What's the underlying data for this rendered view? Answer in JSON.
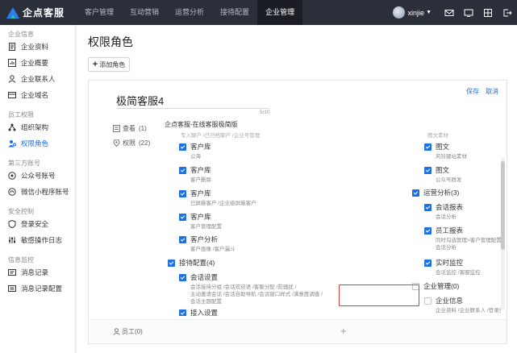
{
  "app": {
    "logo_text": "企点客服"
  },
  "nav": [
    {
      "label": "客户管理"
    },
    {
      "label": "互动营销"
    },
    {
      "label": "运营分析"
    },
    {
      "label": "接待配置"
    },
    {
      "label": "企业管理",
      "active": true
    }
  ],
  "user": {
    "name": "xinjie"
  },
  "top_icons": [
    "mail-icon",
    "monitor-icon",
    "grid-icon",
    "logout-icon"
  ],
  "sidebar": {
    "sections": [
      {
        "title": "企业信息",
        "items": [
          {
            "label": "企业资料",
            "icon": "document-icon"
          },
          {
            "label": "企业概要",
            "icon": "chart-icon"
          },
          {
            "label": "企业联系人",
            "icon": "contact-icon"
          },
          {
            "label": "企业域名",
            "icon": "domain-icon"
          }
        ]
      },
      {
        "title": "员工权限",
        "items": [
          {
            "label": "组织架构",
            "icon": "org-icon"
          },
          {
            "label": "权限角色",
            "icon": "role-icon",
            "active": true
          }
        ]
      },
      {
        "title": "第三方账号",
        "items": [
          {
            "label": "公众号账号",
            "icon": "official-account-icon"
          },
          {
            "label": "微信小程序账号",
            "icon": "miniprogram-icon"
          }
        ]
      },
      {
        "title": "安全控制",
        "items": [
          {
            "label": "登录安全",
            "icon": "shield-icon"
          },
          {
            "label": "敏感操作日志",
            "icon": "sliders-icon"
          }
        ]
      },
      {
        "title": "信息监控",
        "items": [
          {
            "label": "消息记录",
            "icon": "message-icon"
          },
          {
            "label": "消息记录配置",
            "icon": "message-config-icon"
          }
        ]
      }
    ]
  },
  "page": {
    "title": "权限角色",
    "add_button": "添加角色",
    "save": "保存",
    "cancel": "取消",
    "role_name": "极简客服4",
    "role_name_count": "5/10",
    "view_label": "查看",
    "view_count": "(1)",
    "perm_label": "权限",
    "perm_count": "(22)",
    "role_desc": "企点客服-在线客服极简版",
    "staff_label": "员工",
    "staff_count": "(0)",
    "add_staff": "+"
  },
  "permissions": {
    "left_faded": "专入聊户 /已归档聊户 /企业号管理",
    "left": [
      {
        "title": "客户库",
        "desc": "公海",
        "checked": true,
        "level": 2
      },
      {
        "title": "客户库",
        "desc": "客户删除",
        "checked": true,
        "level": 2
      },
      {
        "title": "客户库",
        "desc": "已屏蔽客户 /企业级屏蔽客户",
        "checked": true,
        "level": 2
      },
      {
        "title": "客户库",
        "desc": "客户管理配置",
        "checked": true,
        "level": 2
      },
      {
        "title": "客户分析",
        "desc": "客户画像 /客户漏斗",
        "checked": true,
        "level": 2
      },
      {
        "title": "接待配置(4)",
        "desc": "",
        "checked": true,
        "level": 1
      },
      {
        "title": "会话设置",
        "desc": "会话接待分组 /会话欢迎语 /客服分配 /防骚扰 /",
        "desc2": "主动邀请会话 /会话自助导航 /会话窗口样式 /满意度调查 /",
        "desc3": "会话主题配置",
        "checked": true,
        "level": 2
      },
      {
        "title": "接入设置",
        "desc": "",
        "checked": true,
        "level": 2
      }
    ],
    "right_faded": "图文素材",
    "right": [
      {
        "title": "图文",
        "desc": "风铃建站素材",
        "checked": true,
        "level": 2
      },
      {
        "title": "图文",
        "desc": "公众号群发",
        "checked": true,
        "level": 2
      },
      {
        "title": "运营分析(3)",
        "desc": "",
        "checked": true,
        "level": 1
      },
      {
        "title": "会话报表",
        "desc": "会话分析",
        "checked": true,
        "level": 2
      },
      {
        "title": "员工报表",
        "desc": "同时勾选管理>客户管理配置可查看全公司员工分析报表",
        "desc2": "会话分析",
        "checked": true,
        "level": 2
      },
      {
        "title": "实时监控",
        "desc": "会话监控 /客服监控",
        "checked": true,
        "level": 2
      },
      {
        "title": "企业管理(0)",
        "desc": "",
        "checked": false,
        "level": 1
      },
      {
        "title": "企业信息",
        "desc": "企业资料 /企业联系人 /登录安全 /敏感操作日志",
        "checked": false,
        "level": 2
      }
    ]
  },
  "colors": {
    "accent": "#1f6fe5",
    "highlight": "#e23b3b",
    "topbar": "#2b2f3a"
  }
}
